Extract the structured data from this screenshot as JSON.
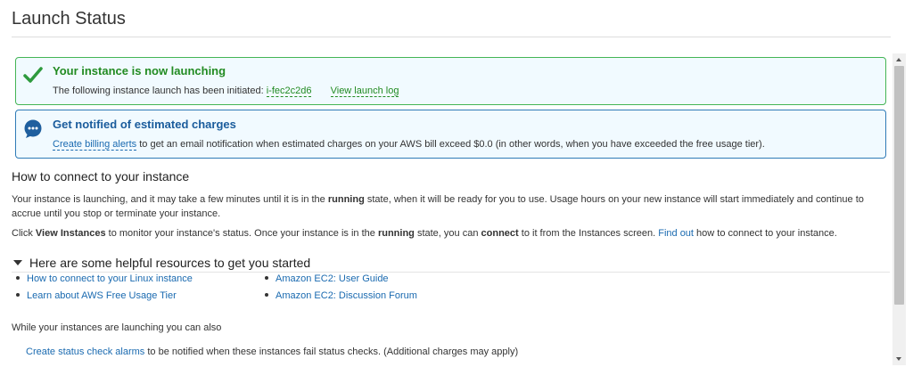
{
  "page": {
    "title": "Launch Status"
  },
  "success_alert": {
    "heading": "Your instance is now launching",
    "body_prefix": "The following instance launch has been initiated:",
    "instance_id": "i-fec2c2d6",
    "log_link": "View launch log",
    "color": "#44b555"
  },
  "info_alert": {
    "heading": "Get notified of estimated charges",
    "link": "Create billing alerts",
    "body_suffix": "to get an email notification when estimated charges on your AWS bill exceed $0.0 (in other words, when you have exceeded the free usage tier).",
    "color": "#2f7bb7"
  },
  "connect": {
    "heading": "How to connect to your instance",
    "p1": {
      "a": "Your instance is launching, and it may take a few minutes until it is in the",
      "b": "running",
      "c": "state, when it will be ready for you to use. Usage hours on your new instance will start immediately and continue to accrue until you stop or terminate your instance."
    },
    "p2": {
      "a": "Click",
      "b": "View Instances",
      "c": "to monitor your instance's status. Once your instance is in the",
      "d": "running",
      "e": "state, you can",
      "f": "connect",
      "g": "to it from the Instances screen.",
      "link": "Find out",
      "h": "how to connect to your instance."
    }
  },
  "resources": {
    "heading": "Here are some helpful resources to get you started",
    "left": [
      "How to connect to your Linux instance",
      "Learn about AWS Free Usage Tier"
    ],
    "right": [
      "Amazon EC2: User Guide",
      "Amazon EC2: Discussion Forum"
    ]
  },
  "also": {
    "text": "While your instances are launching you can also",
    "link": "Create status check alarms",
    "suffix": "to be notified when these instances fail status checks. (Additional charges may apply)"
  },
  "icons": {
    "success": "checkmark-icon",
    "info": "chat-bubble-icon",
    "toggle": "triangle-down-icon"
  }
}
